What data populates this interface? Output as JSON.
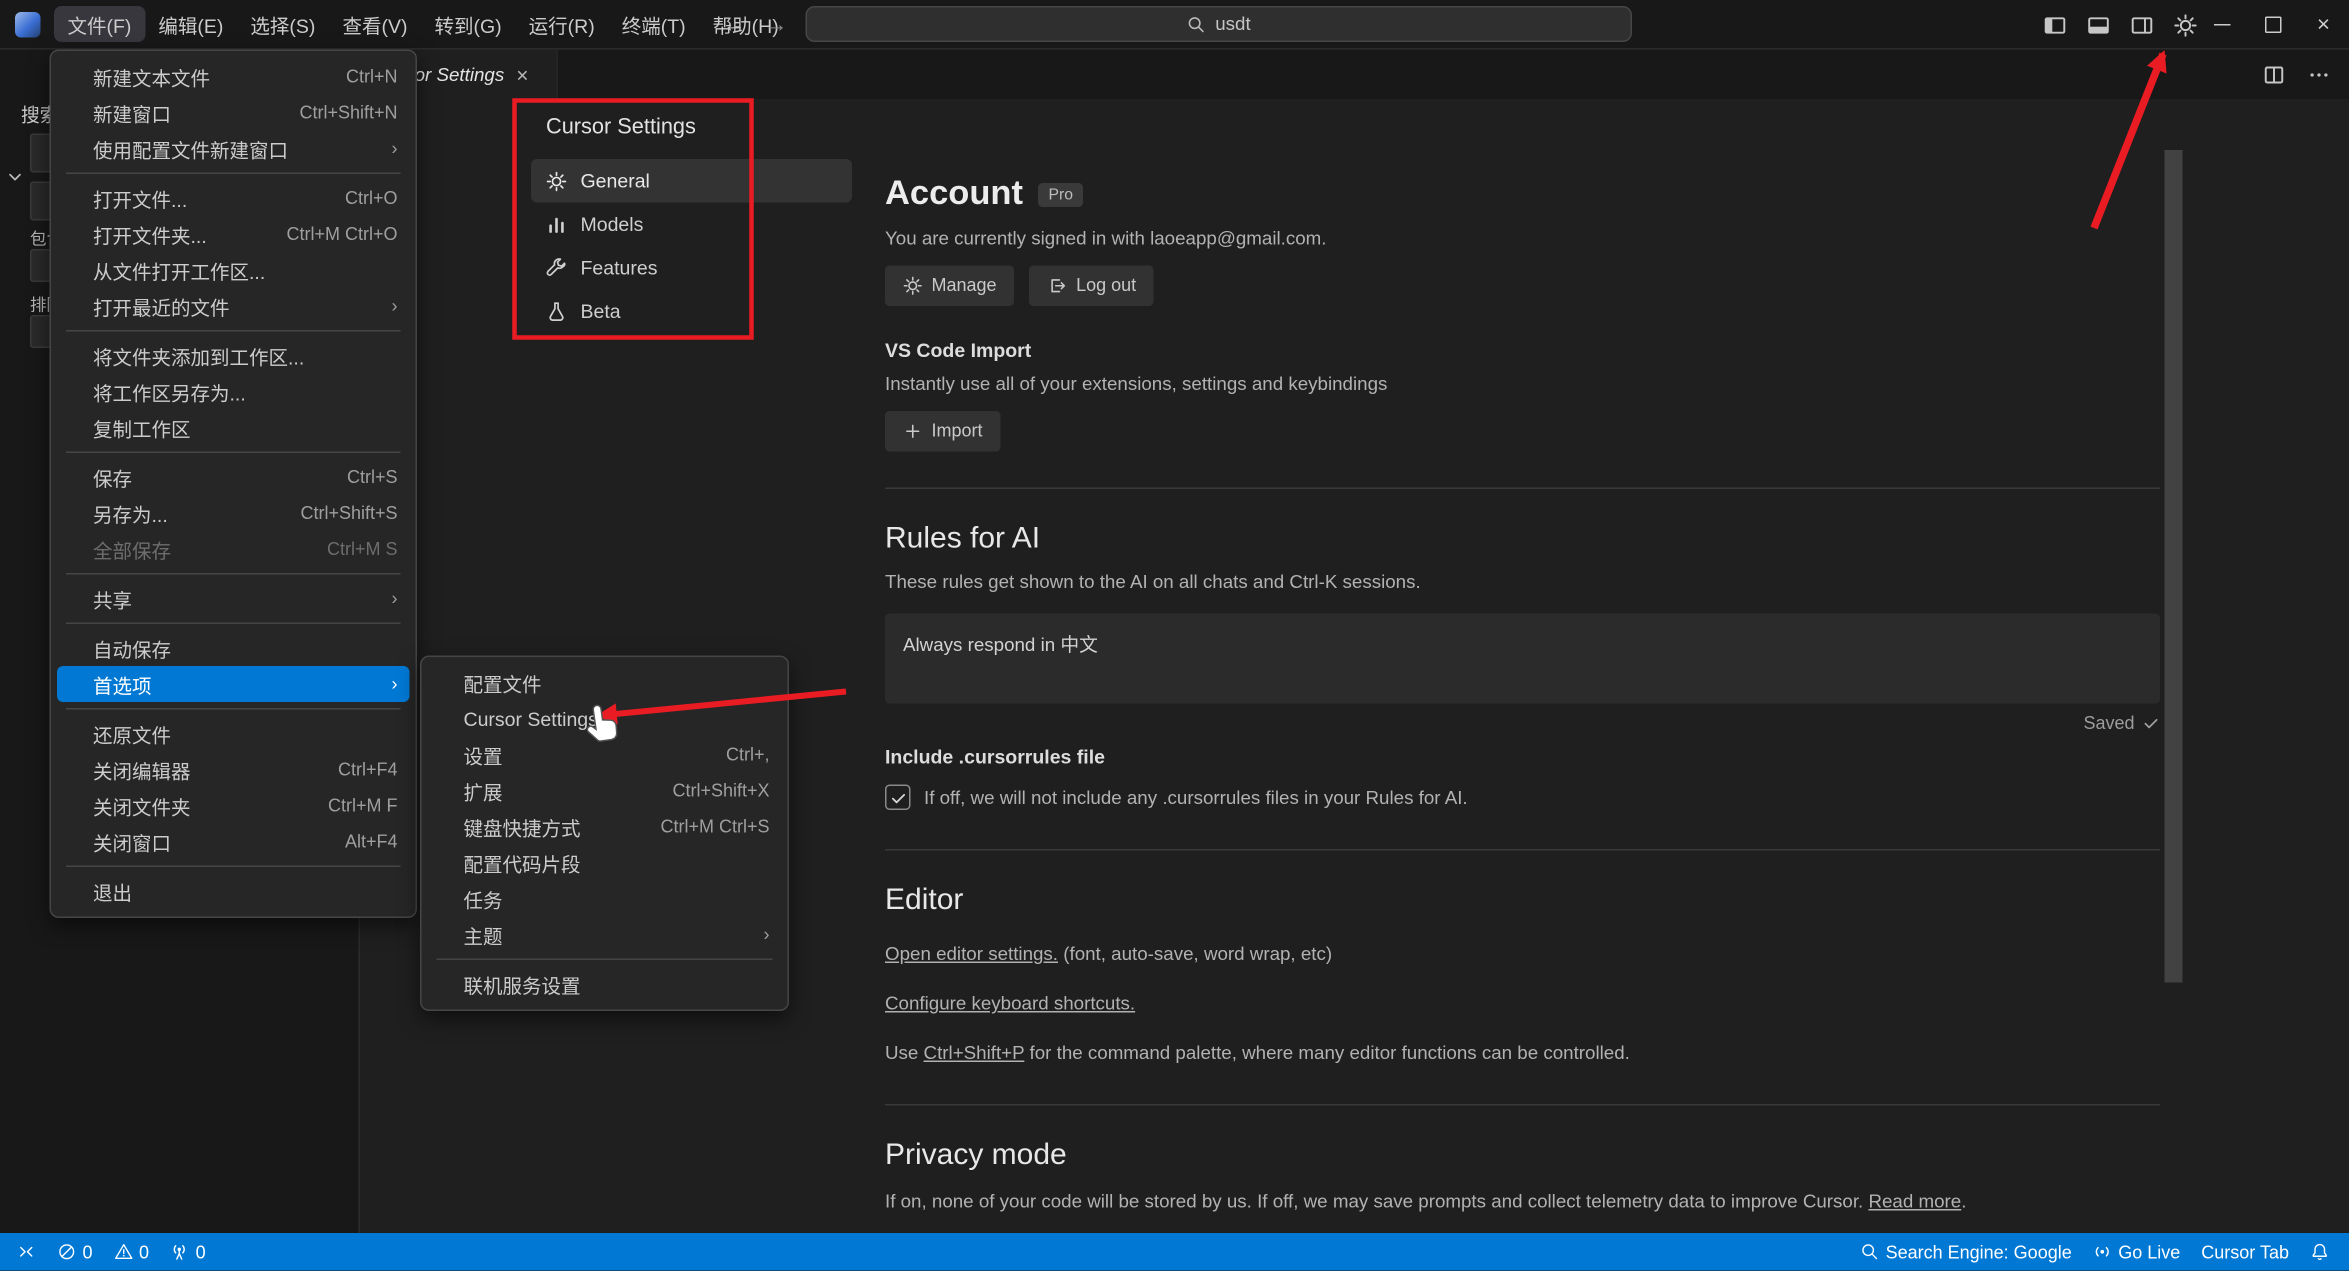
{
  "colors": {
    "statusbar": "#0078d4",
    "menu_highlight": "#0078d4",
    "annotation": "#ea1c23"
  },
  "titlebar": {
    "menus": [
      "文件(F)",
      "编辑(E)",
      "选择(S)",
      "查看(V)",
      "转到(G)",
      "运行(R)",
      "终端(T)",
      "帮助(H)"
    ],
    "back_icon": "←",
    "forward_icon": "→",
    "search": {
      "icon": "search-icon",
      "value": "usdt"
    },
    "layout_icons": [
      "layout-sidebar-left-icon",
      "layout-panel-icon",
      "layout-sidebar-right-icon"
    ],
    "gear_icon": "gear-icon",
    "window_controls": {
      "minimize": "minimize-icon",
      "maximize": "maximize-icon",
      "close_glyph": "×"
    }
  },
  "tabbar": {
    "tabs": [
      {
        "label": "Cursor Settings",
        "close_glyph": "×",
        "active": true
      }
    ],
    "actions": [
      "split-editor-icon",
      "more-icon"
    ]
  },
  "sidebar": {
    "title": "搜索",
    "toggle_icon": "chevron-down-icon",
    "fields": [
      {
        "label": "包含"
      },
      {
        "label": "排除"
      }
    ]
  },
  "file_menu": {
    "items": [
      {
        "label": "新建文本文件",
        "shortcut": "Ctrl+N"
      },
      {
        "label": "新建窗口",
        "shortcut": "Ctrl+Shift+N"
      },
      {
        "label": "使用配置文件新建窗口",
        "submenu": true
      },
      {
        "separator": true
      },
      {
        "label": "打开文件...",
        "shortcut": "Ctrl+O"
      },
      {
        "label": "打开文件夹...",
        "shortcut": "Ctrl+M Ctrl+O"
      },
      {
        "label": "从文件打开工作区..."
      },
      {
        "label": "打开最近的文件",
        "submenu": true
      },
      {
        "separator": true
      },
      {
        "label": "将文件夹添加到工作区..."
      },
      {
        "label": "将工作区另存为..."
      },
      {
        "label": "复制工作区"
      },
      {
        "separator": true
      },
      {
        "label": "保存",
        "shortcut": "Ctrl+S"
      },
      {
        "label": "另存为...",
        "shortcut": "Ctrl+Shift+S"
      },
      {
        "label": "全部保存",
        "shortcut": "Ctrl+M S",
        "disabled": true
      },
      {
        "separator": true
      },
      {
        "label": "共享",
        "submenu": true
      },
      {
        "separator": true
      },
      {
        "label": "自动保存"
      },
      {
        "label": "首选项",
        "submenu": true,
        "highlighted": true
      },
      {
        "separator": true
      },
      {
        "label": "还原文件"
      },
      {
        "label": "关闭编辑器",
        "shortcut": "Ctrl+F4"
      },
      {
        "label": "关闭文件夹",
        "shortcut": "Ctrl+M F"
      },
      {
        "label": "关闭窗口",
        "shortcut": "Alt+F4"
      },
      {
        "separator": true
      },
      {
        "label": "退出"
      }
    ]
  },
  "preferences_submenu": {
    "items": [
      {
        "label": "配置文件"
      },
      {
        "label": "Cursor Settings"
      },
      {
        "label": "设置",
        "shortcut": "Ctrl+,"
      },
      {
        "label": "扩展",
        "shortcut": "Ctrl+Shift+X"
      },
      {
        "label": "键盘快捷方式",
        "shortcut": "Ctrl+M Ctrl+S"
      },
      {
        "label": "配置代码片段"
      },
      {
        "label": "任务"
      },
      {
        "label": "主题",
        "submenu": true
      },
      {
        "separator": true
      },
      {
        "label": "联机服务设置"
      }
    ]
  },
  "settings": {
    "title": "Cursor Settings",
    "nav": [
      {
        "icon": "gear-icon",
        "label": "General",
        "selected": true
      },
      {
        "icon": "bars-icon",
        "label": "Models"
      },
      {
        "icon": "wrench-icon",
        "label": "Features"
      },
      {
        "icon": "flask-icon",
        "label": "Beta"
      }
    ],
    "account": {
      "heading": "Account",
      "badge": "Pro",
      "signed_in_text": "You are currently signed in with laoeapp@gmail.com.",
      "manage_label": "Manage",
      "logout_label": "Log out"
    },
    "vscode_import": {
      "heading": "VS Code Import",
      "description": "Instantly use all of your extensions, settings and keybindings",
      "import_label": "Import"
    },
    "rules_for_ai": {
      "heading": "Rules for AI",
      "description": "These rules get shown to the AI on all chats and Ctrl-K sessions.",
      "textarea_value": "Always respond in 中文",
      "saved_label": "Saved"
    },
    "cursorrules": {
      "heading": "Include .cursorrules file",
      "checked": true,
      "checkbox_label": "If off, we will not include any .cursorrules files in your Rules for AI."
    },
    "editor": {
      "heading": "Editor",
      "link_settings": "Open editor settings.",
      "settings_suffix": " (font, auto-save, word wrap, etc)",
      "link_shortcuts": "Configure keyboard shortcuts.",
      "palette_prefix": "Use ",
      "palette_link": "Ctrl+Shift+P",
      "palette_suffix": " for the command palette, where many editor functions can be controlled."
    },
    "privacy": {
      "heading": "Privacy mode",
      "text": "If on, none of your code will be stored by us. If off, we may save prompts and collect telemetry data to improve Cursor. ",
      "read_more": "Read more",
      "period": "."
    }
  },
  "statusbar": {
    "left": [
      {
        "name": "remote-indicator",
        "icon": "remote-icon"
      },
      {
        "name": "errors-count",
        "icon": "error-circle-icon",
        "label": "0"
      },
      {
        "name": "warnings-count",
        "icon": "warning-triangle-icon",
        "label": "0"
      },
      {
        "name": "ports-count",
        "icon": "radio-tower-icon",
        "label": "0"
      }
    ],
    "right": [
      {
        "name": "search-engine-status",
        "icon": "search-icon",
        "label": "Search Engine: Google"
      },
      {
        "name": "go-live-button",
        "icon": "broadcast-icon",
        "label": "Go Live"
      },
      {
        "name": "cursor-tab-status",
        "label": "Cursor Tab"
      },
      {
        "name": "notifications-bell",
        "icon": "bell-icon"
      }
    ]
  },
  "annotations": {
    "color": "#ea1c23",
    "box": "cursor-settings-nav-highlight",
    "arrows": [
      "arrow-to-settings-gear",
      "arrow-to-cursor-settings-menu-item"
    ]
  }
}
